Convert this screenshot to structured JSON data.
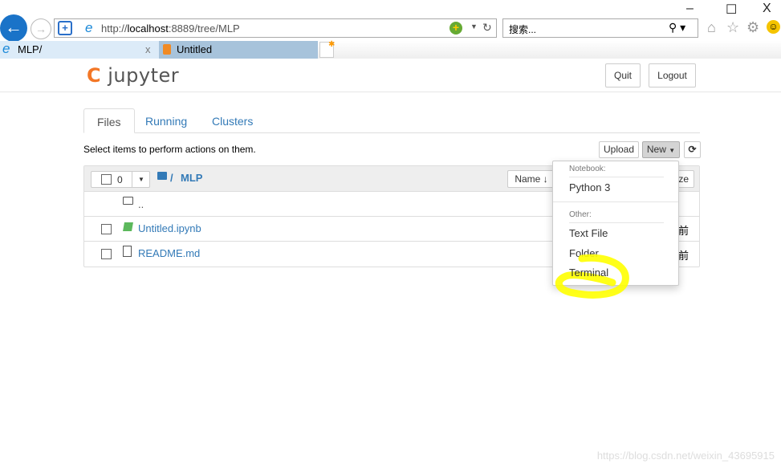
{
  "browser": {
    "url_prefix": "http://",
    "url_host": "localhost",
    "url_rest": ":8889/tree/MLP",
    "search_placeholder": "搜索...",
    "tabs": [
      {
        "label": "MLP/",
        "close": "x"
      },
      {
        "label": "Untitled"
      }
    ],
    "window": {
      "minimize": "–",
      "maximize": "☐",
      "close": "X"
    }
  },
  "header": {
    "logo": "jupyter",
    "quit": "Quit",
    "logout": "Logout"
  },
  "nav": {
    "tabs": [
      "Files",
      "Running",
      "Clusters"
    ],
    "active": "Files"
  },
  "toolbar": {
    "hint": "Select items to perform actions on them.",
    "upload": "Upload",
    "new": "New",
    "refresh": "⟳"
  },
  "list": {
    "selected_count": "0",
    "breadcrumb_sep": "/",
    "folder": "MLP",
    "sort_label": "Name",
    "size_label": "ze",
    "rows": [
      {
        "name": "..",
        "type": "folder"
      },
      {
        "name": "Untitled.ipynb",
        "type": "notebook",
        "modified": "前"
      },
      {
        "name": "README.md",
        "type": "file",
        "modified": "前"
      }
    ]
  },
  "new_menu": {
    "notebook_header": "Notebook:",
    "notebook_items": [
      "Python 3"
    ],
    "other_header": "Other:",
    "other_items": [
      "Text File",
      "Folder",
      "Terminal"
    ]
  },
  "annotation": {
    "color": "#ffff00",
    "target": "Terminal"
  },
  "watermark": "https://blog.csdn.net/weixin_43695915",
  "colors": {
    "link": "#337ab7",
    "jupyter_orange": "#f37726",
    "ie_blue": "#1a73c8"
  }
}
